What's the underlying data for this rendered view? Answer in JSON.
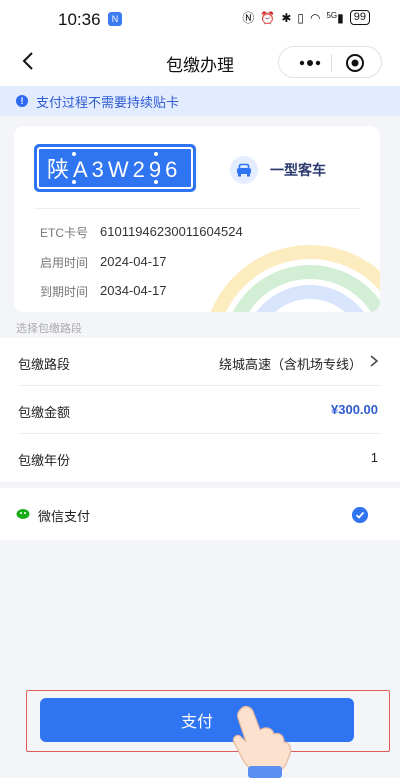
{
  "status_bar": {
    "time": "10:36",
    "battery": "99",
    "signal": "5G"
  },
  "nav": {
    "title": "包缴办理"
  },
  "notice": {
    "text": "支付过程不需要持续贴卡"
  },
  "vehicle": {
    "plate": "陕A3W296",
    "type": "一型客车",
    "etc_label": "ETC卡号",
    "etc_number": "61011946230011604524",
    "start_label": "启用时间",
    "start_date": "2024-04-17",
    "end_label": "到期时间",
    "end_date": "2034-04-17"
  },
  "section": {
    "label": "选择包缴路段"
  },
  "form": {
    "route_label": "包缴路段",
    "route_value": "绕城高速（含机场专线）",
    "amount_label": "包缴金额",
    "amount_value": "¥300.00",
    "years_label": "包缴年份",
    "years_value": "1"
  },
  "payment": {
    "method": "微信支付",
    "selected": true
  },
  "actions": {
    "pay_label": "支付"
  },
  "colors": {
    "accent": "#2f74f0",
    "notice_bg": "#e3ecff",
    "highlight": "#e05a5a"
  }
}
